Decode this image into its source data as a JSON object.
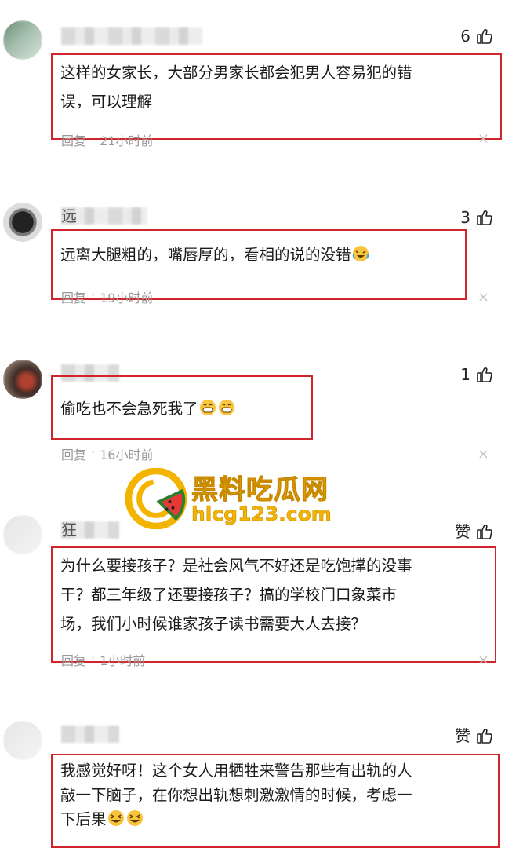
{
  "comments": [
    {
      "username_visible": "",
      "likes": "6",
      "text_lines": [
        "这样的女家长，大部分男家长都会犯男人容易犯的错",
        "误，可以理解"
      ],
      "reply_label": "回复",
      "separator": "·",
      "time": "21小时前",
      "close": "×"
    },
    {
      "username_visible": "远",
      "likes": "3",
      "text_lines": [
        "远离大腿粗的，嘴唇厚的，看相的说的没错"
      ],
      "emoji_after": "laughing-crying-emoji",
      "reply_label": "回复",
      "separator": "·",
      "time": "19小时前",
      "close": "×"
    },
    {
      "username_visible": "",
      "likes": "1",
      "text_lines": [
        "偷吃也不会急死我了"
      ],
      "emoji_after": "grinning-emoji x2",
      "reply_label": "回复",
      "separator": "·",
      "time": "16小时前",
      "close": "×"
    },
    {
      "username_visible": "狂",
      "likes": "赞",
      "text_lines": [
        "为什么要接孩子？是社会风气不好还是吃饱撑的没事",
        "干？都三年级了还要接孩子？搞的学校门口象菜市",
        "场，我们小时候谁家孩子读书需要大人去接？"
      ],
      "reply_label": "回复",
      "separator": "·",
      "time": "1小时前",
      "close": "×"
    },
    {
      "username_visible": "",
      "likes": "赞",
      "text_lines": [
        "我感觉好呀！这个女人用牺牲来警告那些有出轨的人",
        "敲一下脑子，在你想出轨想刺激激情的时候，考虑一",
        "下后果"
      ],
      "emoji_after": "grinning-squint-emoji x2"
    }
  ],
  "watermark": {
    "title": "黑料吃瓜网",
    "url": "hlcg123.com"
  },
  "colors": {
    "highlight_border": "#d0262b",
    "watermark_gold": "#f3b400",
    "meta_gray": "#999999"
  }
}
